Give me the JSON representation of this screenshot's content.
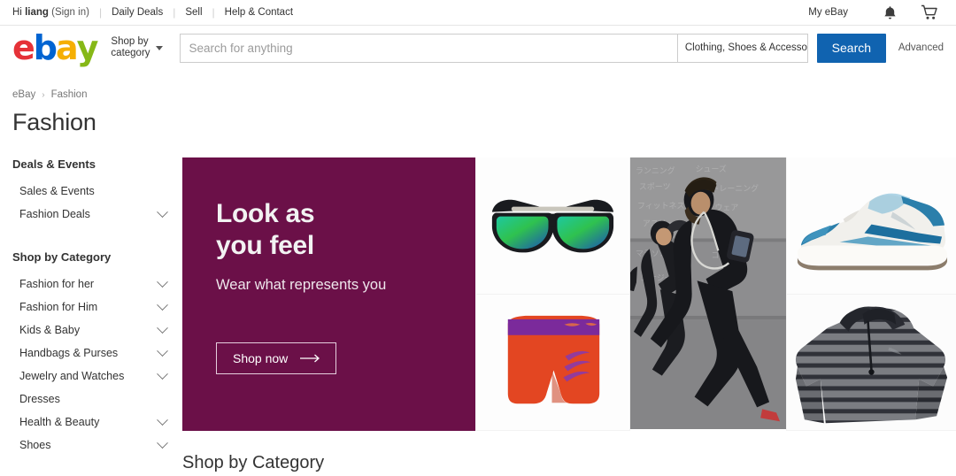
{
  "topbar": {
    "greeting_prefix": "Hi ",
    "greeting_user": "liang",
    "signin": "(Sign in)",
    "links": [
      "Daily Deals",
      "Sell",
      "Help & Contact"
    ],
    "my_ebay": "My eBay",
    "bell_icon": "bell-icon",
    "cart_icon": "cart-icon"
  },
  "header": {
    "logo": {
      "e": "e",
      "b": "b",
      "a": "a",
      "y": "y"
    },
    "shop_by_category": "Shop by\ncategory",
    "shop_by_line1": "Shop by",
    "shop_by_line2": "category",
    "search_placeholder": "Search for anything",
    "search_value": "",
    "category_selected": "Clothing, Shoes & Accesso",
    "search_button": "Search",
    "advanced_link": "Advanced"
  },
  "breadcrumb": {
    "items": [
      "eBay",
      "Fashion"
    ],
    "separator": "›"
  },
  "page_title": "Fashion",
  "sidebar": {
    "deals_heading": "Deals & Events",
    "deals_items": [
      {
        "label": "Sales & Events",
        "expandable": false
      },
      {
        "label": "Fashion Deals",
        "expandable": true
      }
    ],
    "category_heading": "Shop by Category",
    "category_items": [
      {
        "label": "Fashion for her",
        "expandable": true
      },
      {
        "label": "Fashion for Him",
        "expandable": true
      },
      {
        "label": "Kids & Baby",
        "expandable": true
      },
      {
        "label": "Handbags & Purses",
        "expandable": true
      },
      {
        "label": "Jewelry and Watches",
        "expandable": true
      },
      {
        "label": "Dresses",
        "expandable": false
      },
      {
        "label": "Health & Beauty",
        "expandable": true
      },
      {
        "label": "Shoes",
        "expandable": true
      }
    ]
  },
  "hero": {
    "headline_line1": "Look as",
    "headline_line2": "you feel",
    "subhead": "Wear what represents you",
    "cta_label": "Shop now",
    "background_color": "#6b1048",
    "arrow_icon": "arrow-right-icon"
  },
  "tiles": [
    {
      "name": "sunglasses-tile",
      "alt": "Mirrored green lens sunglasses"
    },
    {
      "name": "nike-shorts-tile",
      "alt": "Orange Nike Pro compression shorts"
    },
    {
      "name": "runners-tile",
      "alt": "Two runners in black athletic wear by a concrete wall"
    },
    {
      "name": "sneaker-tile",
      "alt": "White and blue running sneaker"
    },
    {
      "name": "striped-pullover-tile",
      "alt": "Gray striped quarter-zip pullover"
    }
  ],
  "section_heading": "Shop by Category",
  "colors": {
    "accent_blue": "#1063b0",
    "logo_red": "#e53238",
    "logo_blue": "#0064d2",
    "logo_yellow": "#f5af02",
    "logo_green": "#86b817",
    "hero_magenta": "#6b1048"
  }
}
